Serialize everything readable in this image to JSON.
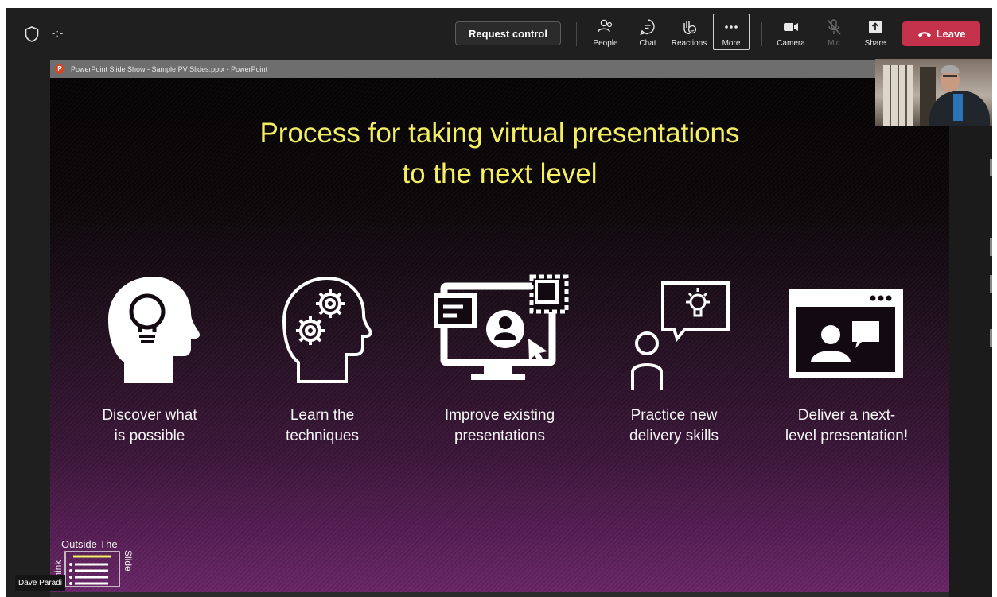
{
  "topbar": {
    "timer": "-:-",
    "request_control_label": "Request control",
    "tools": {
      "people": "People",
      "chat": "Chat",
      "reactions": "Reactions",
      "more": "More",
      "camera": "Camera",
      "mic": "Mic",
      "share": "Share"
    },
    "leave_label": "Leave"
  },
  "window_title": "PowerPoint Slide Show - Sample PV Slides.pptx - PowerPoint",
  "slide": {
    "title_line1": "Process for taking virtual presentations",
    "title_line2": "to the next level",
    "steps": [
      {
        "label": "Discover what\nis possible",
        "icon": "lightbulb-head-icon"
      },
      {
        "label": "Learn the\ntechniques",
        "icon": "gears-head-icon"
      },
      {
        "label": "Improve existing\npresentations",
        "icon": "monitor-edit-icon"
      },
      {
        "label": "Practice new\ndelivery skills",
        "icon": "person-idea-icon"
      },
      {
        "label": "Deliver a next-\nlevel presentation!",
        "icon": "video-call-window-icon"
      }
    ],
    "logo": {
      "top": "Outside The",
      "left": "Think",
      "right": "Slide"
    }
  },
  "participant": {
    "name": "Dave Paradi"
  },
  "colors": {
    "title_yellow": "#f3ee62",
    "leave_red": "#c4314b",
    "topbar_bg": "#1f1f1f",
    "slide_purple": "#6a2668"
  }
}
